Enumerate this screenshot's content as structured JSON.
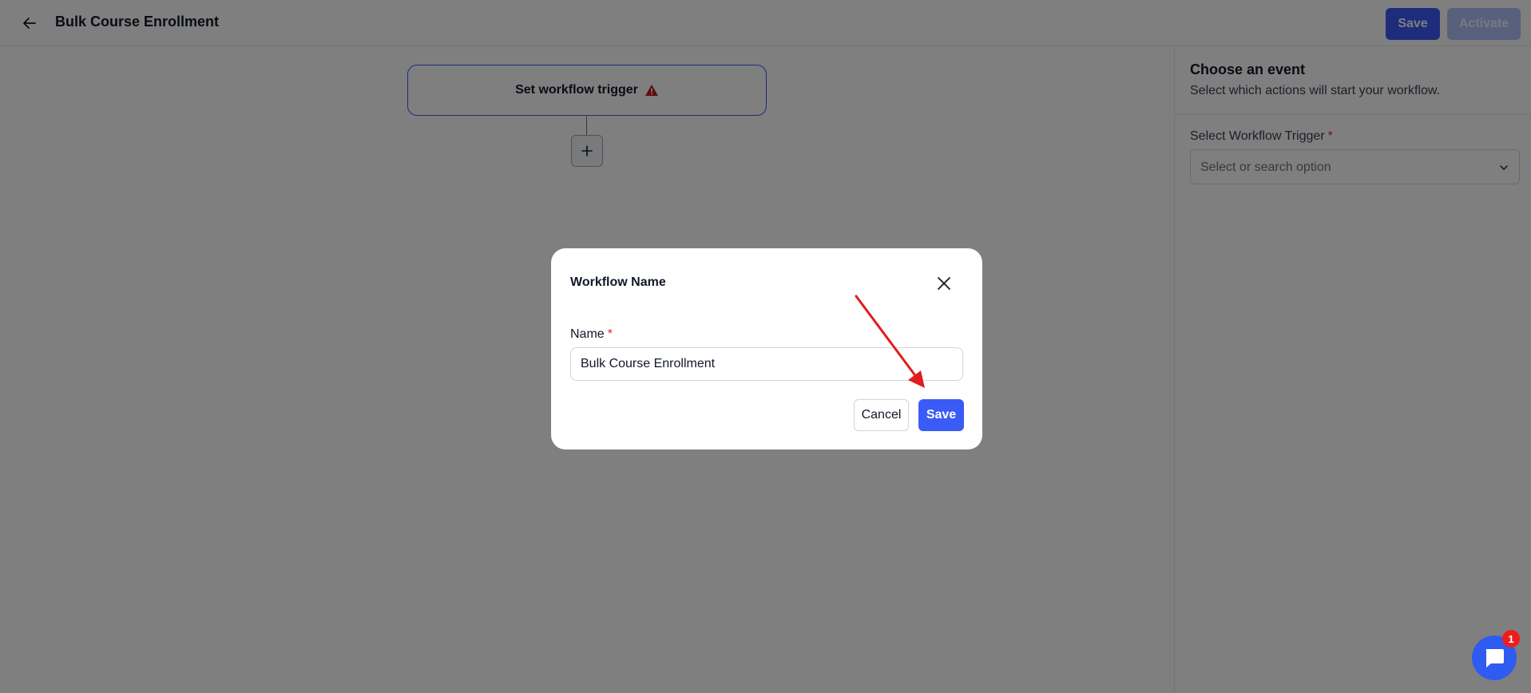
{
  "header": {
    "title": "Bulk Course Enrollment",
    "save_label": "Save",
    "activate_label": "Activate"
  },
  "canvas": {
    "trigger_node_label": "Set workflow trigger"
  },
  "panel": {
    "title": "Choose an event",
    "subtitle": "Select which actions will start your workflow.",
    "field_label": "Select Workflow Trigger",
    "required_mark": "*",
    "select_placeholder": "Select or search option"
  },
  "modal": {
    "title": "Workflow Name",
    "name_label": "Name",
    "required_mark": "*",
    "name_value": "Bulk Course Enrollment",
    "cancel_label": "Cancel",
    "save_label": "Save"
  },
  "chat": {
    "badge_count": "1"
  },
  "colors": {
    "primary": "#3b5bf6",
    "primary_disabled": "#b3c1f8",
    "warning": "#b91c1c",
    "annotation_arrow": "#e11d1d",
    "badge": "#ef1c1c"
  },
  "icons": {
    "back": "arrow-left-icon",
    "warning": "warning-triangle-icon",
    "add": "plus-icon",
    "close": "close-icon",
    "dropdown": "chevron-down-icon",
    "chat": "chat-bubble-icon"
  }
}
